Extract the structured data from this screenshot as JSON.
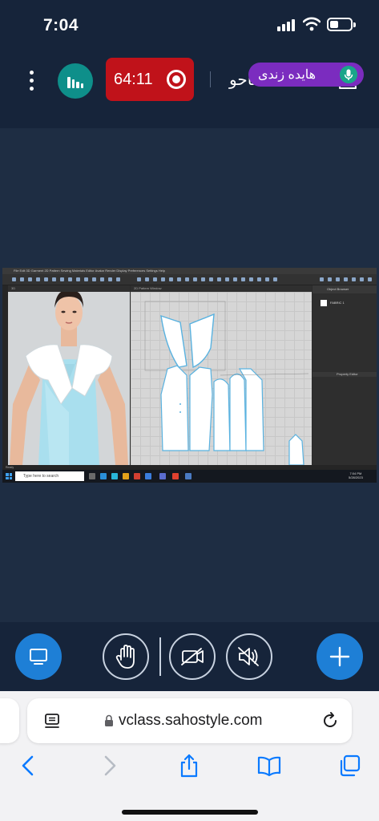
{
  "status_bar": {
    "time": "7:04",
    "icons": [
      "cellular-signal-icon",
      "wifi-icon",
      "battery-icon"
    ]
  },
  "header": {
    "menu_icon": "more-vertical-icon",
    "stats_icon": "stats-icon",
    "recording_time": "64:11",
    "recording_icon": "record-icon",
    "title": "صاحو - Clo3D",
    "profile_icon": "user-icon",
    "active_speaker": "هایده زندی",
    "speaker_icon": "mic-icon",
    "colors": {
      "recording": "#c0121a",
      "speaker": "#7b2cbf",
      "stats": "#0e8f8a"
    }
  },
  "shared_screen": {
    "menu": "File  Edit  3D Garment  2D Pattern  Sewing  Materials  Editor  Avatar  Render  Display  Preferences  Settings  Help",
    "view_3d_tab": "3D",
    "view_2d_tab": "2D Pattern Window",
    "object_browser": "Object Browser",
    "fabric_label": "FABRIC 1",
    "property_editor": "Property Editor",
    "search_placeholder": "Type here to search",
    "clock_time": "7:04 PM",
    "clock_date": "5/28/2023",
    "status_text": "Ready"
  },
  "controls": {
    "share_screen_icon": "monitor-icon",
    "raise_hand_icon": "hand-icon",
    "camera_icon": "camera-off-icon",
    "audio_icon": "speaker-icon",
    "add_icon": "plus-icon",
    "accent": "#1e7fd6"
  },
  "browser": {
    "url": "vclass.sahostyle.com",
    "reader_icon": "reader-icon",
    "lock_icon": "lock-icon",
    "reload_icon": "reload-icon",
    "nav": [
      "back-icon",
      "forward-icon",
      "share-icon",
      "bookmarks-icon",
      "tabs-icon"
    ],
    "accent": "#0a7aff"
  }
}
